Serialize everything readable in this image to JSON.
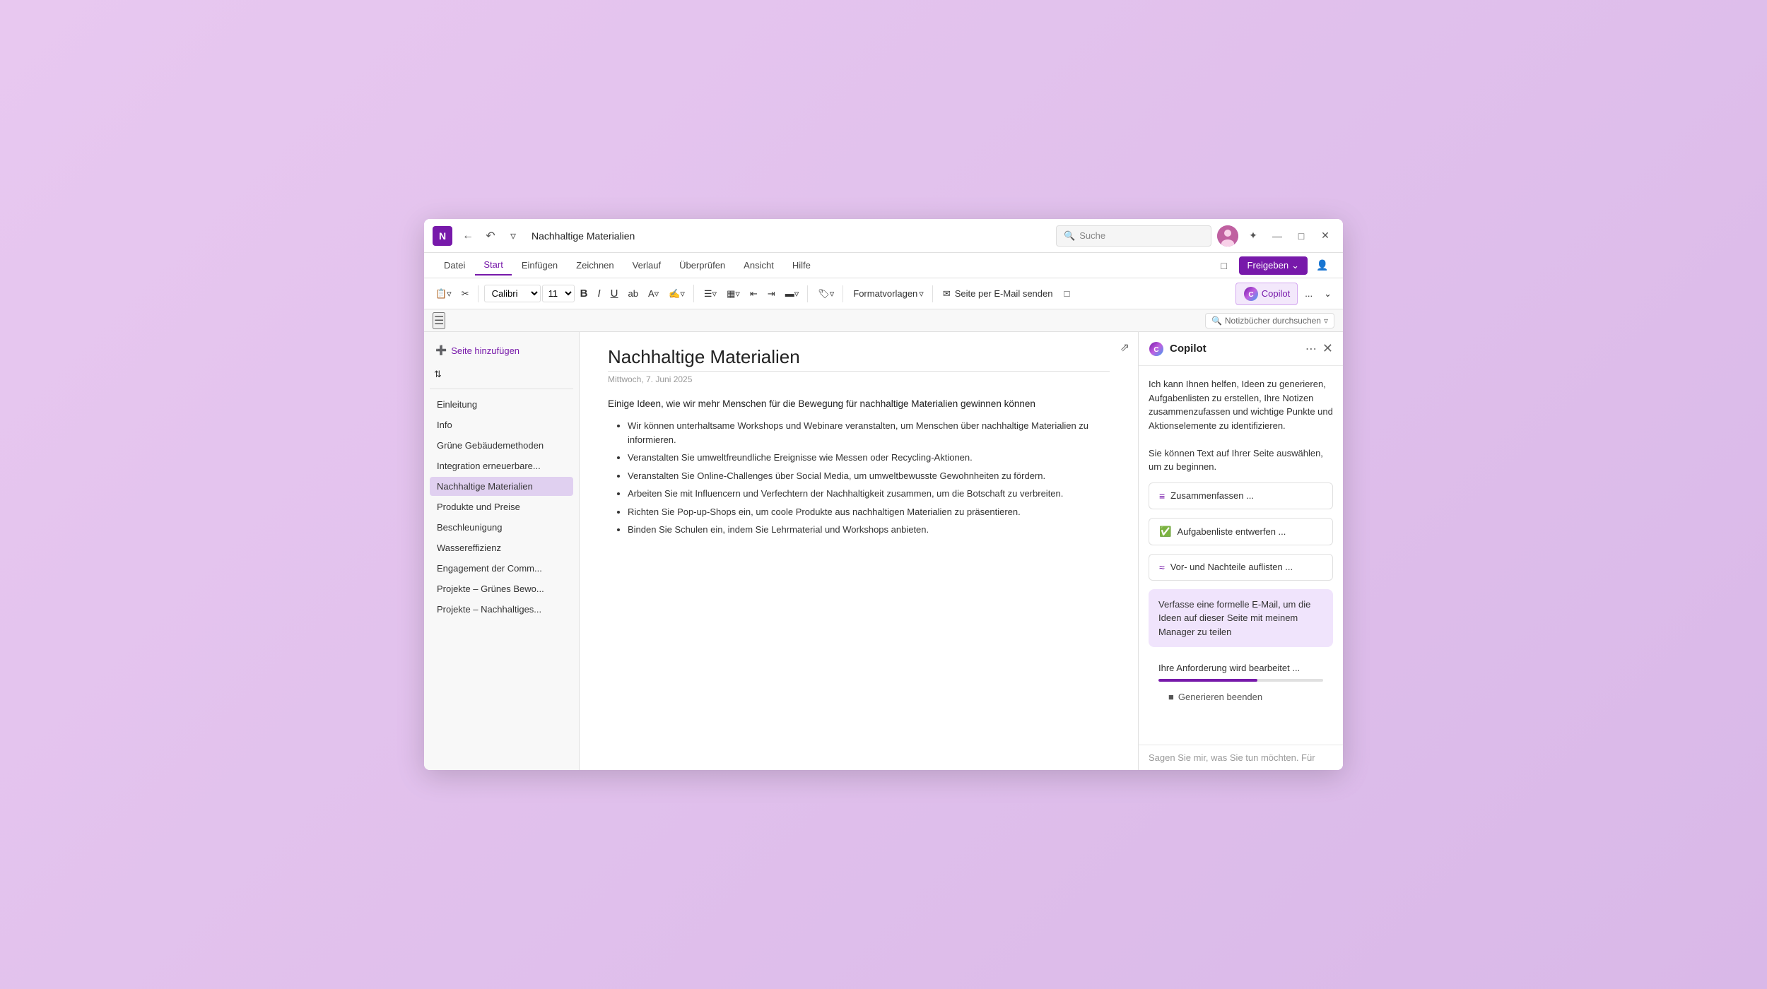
{
  "window": {
    "title": "Nachhaltige Materialien",
    "logo_text": "N",
    "search_placeholder": "Suche"
  },
  "ribbon": {
    "tabs": [
      {
        "label": "Datei",
        "active": false
      },
      {
        "label": "Start",
        "active": true
      },
      {
        "label": "Einfügen",
        "active": false
      },
      {
        "label": "Zeichnen",
        "active": false
      },
      {
        "label": "Verlauf",
        "active": false
      },
      {
        "label": "Überprüfen",
        "active": false
      },
      {
        "label": "Ansicht",
        "active": false
      },
      {
        "label": "Hilfe",
        "active": false
      }
    ],
    "share_button": "Freigeben",
    "more_label": "..."
  },
  "toolbar": {
    "font_name": "Calibri",
    "font_size": "11",
    "bold": "B",
    "italic": "I",
    "underline": "U",
    "strikethrough": "ab",
    "format_styles": "Formatvorlagen",
    "email_page": "Seite per E-Mail senden",
    "copilot_btn": "Copilot",
    "more_btn": "..."
  },
  "sub_toolbar": {
    "notebook_search_placeholder": "Notizbücher durchsuchen"
  },
  "sidebar": {
    "add_page_btn": "Seite hinzufügen",
    "items": [
      {
        "label": "Einleitung",
        "active": false
      },
      {
        "label": "Info",
        "active": false
      },
      {
        "label": "Grüne Gebäudemethoden",
        "active": false
      },
      {
        "label": "Integration erneuerbare...",
        "active": false
      },
      {
        "label": "Nachhaltige Materialien",
        "active": true
      },
      {
        "label": "Produkte und Preise",
        "active": false
      },
      {
        "label": "Beschleunigung",
        "active": false
      },
      {
        "label": "Wassereffizienz",
        "active": false
      },
      {
        "label": "Engagement der Comm...",
        "active": false
      },
      {
        "label": "Projekte – Grünes Bewo...",
        "active": false
      },
      {
        "label": "Projekte – Nachhaltiges...",
        "active": false
      }
    ]
  },
  "content": {
    "title": "Nachhaltige Materialien",
    "date": "Mittwoch, 7. Juni 2025",
    "intro": "Einige Ideen, wie wir mehr Menschen für die Bewegung für nachhaltige Materialien gewinnen können",
    "bullets": [
      "Wir können unterhaltsame Workshops und Webinare veranstalten, um Menschen über nachhaltige Materialien zu informieren.",
      "Veranstalten Sie umweltfreundliche Ereignisse wie Messen oder Recycling-Aktionen.",
      "Veranstalten Sie Online-Challenges über Social Media, um umweltbewusste Gewohnheiten zu fördern.",
      "Arbeiten Sie mit Influencern und Verfechtern der Nachhaltigkeit zusammen, um die Botschaft zu verbreiten.",
      "Richten Sie Pop-up-Shops ein, um coole Produkte aus nachhaltigen Materialien zu präsentieren.",
      "Binden Sie Schulen ein, indem Sie Lehrmaterial und Workshops anbieten."
    ]
  },
  "copilot": {
    "title": "Copilot",
    "intro_text": "Ich kann Ihnen helfen, Ideen zu generieren, Aufgabenlisten zu erstellen, Ihre Notizen zusammenzufassen und wichtige Punkte und Aktionselemente zu identifizieren.\n\nSie können Text auf Ihrer Seite auswählen, um zu beginnen.",
    "actions": [
      {
        "icon": "≡",
        "label": "Zusammenfassen ..."
      },
      {
        "icon": "☑",
        "label": "Aufgabenliste entwerfen ..."
      },
      {
        "icon": "≈",
        "label": "Vor- und Nachteile auflisten ..."
      }
    ],
    "user_message": "Verfasse eine formelle E-Mail, um die Ideen auf dieser Seite mit meinem Manager zu teilen",
    "processing_text": "Ihre Anforderung wird bearbeitet ...",
    "stop_generate_btn": "Generieren beenden",
    "input_placeholder": "Sagen Sie mir, was Sie tun möchten. Für"
  }
}
